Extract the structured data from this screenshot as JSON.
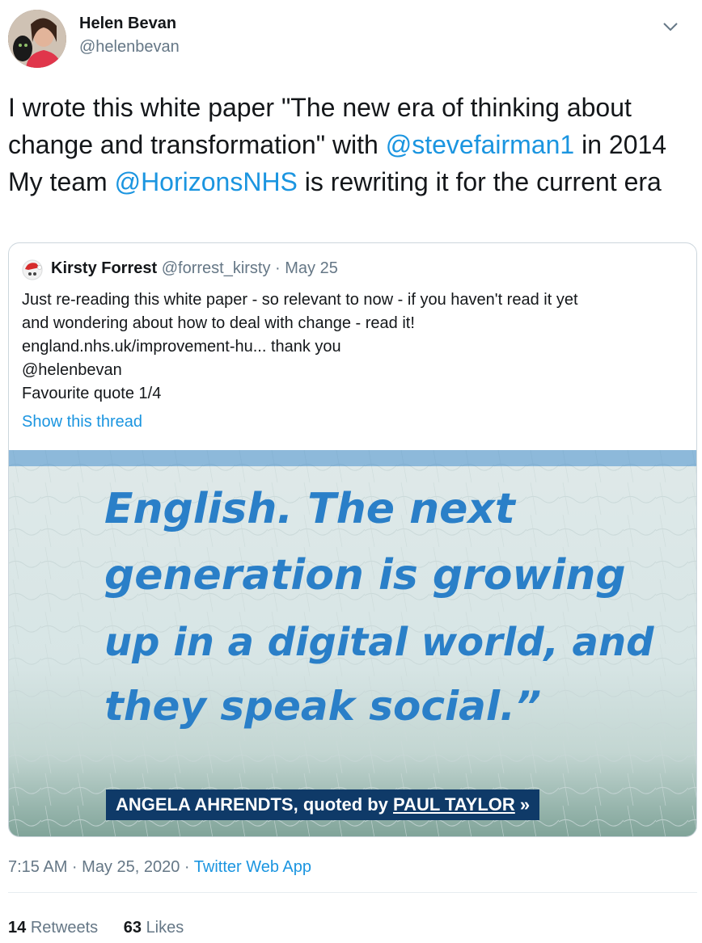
{
  "author": {
    "name": "Helen Bevan",
    "handle": "@helenbevan"
  },
  "tweet": {
    "text_parts": [
      "I wrote this white paper \"The new era of thinking about change and transformation\" with ",
      "@stevefairman1",
      " in 2014  My team ",
      "@HorizonsNHS",
      " is rewriting it for the current era"
    ]
  },
  "quoted": {
    "name": "Kirsty Forrest",
    "handle_date": "@forrest_kirsty · May 25",
    "lines": [
      "Just re-reading this white paper - so relevant to now - if you haven't read it yet",
      "and wondering about how to deal with change - read it!",
      "england.nhs.uk/improvement-hu... thank you",
      "@helenbevan",
      "Favourite quote 1/4"
    ],
    "show_thread": "Show this thread",
    "image": {
      "quote_lines": [
        "English. The next",
        "generation is growing",
        "up in a digital world, and",
        "they speak social.”"
      ],
      "caption_prefix": "ANGELA AHRENDTS, quoted by ",
      "caption_name": "PAUL TAYLOR",
      "caption_arrow": "»"
    }
  },
  "meta": {
    "time_date": "7:15 AM · May 25, 2020 · ",
    "source": "Twitter Web App"
  },
  "stats": {
    "retweets_count": "14",
    "retweets_label": "Retweets",
    "likes_count": "63",
    "likes_label": "Likes"
  },
  "colors": {
    "link": "#1b95e0",
    "quote_text": "#2a7fc8",
    "caption_bg": "#0f3a68"
  }
}
